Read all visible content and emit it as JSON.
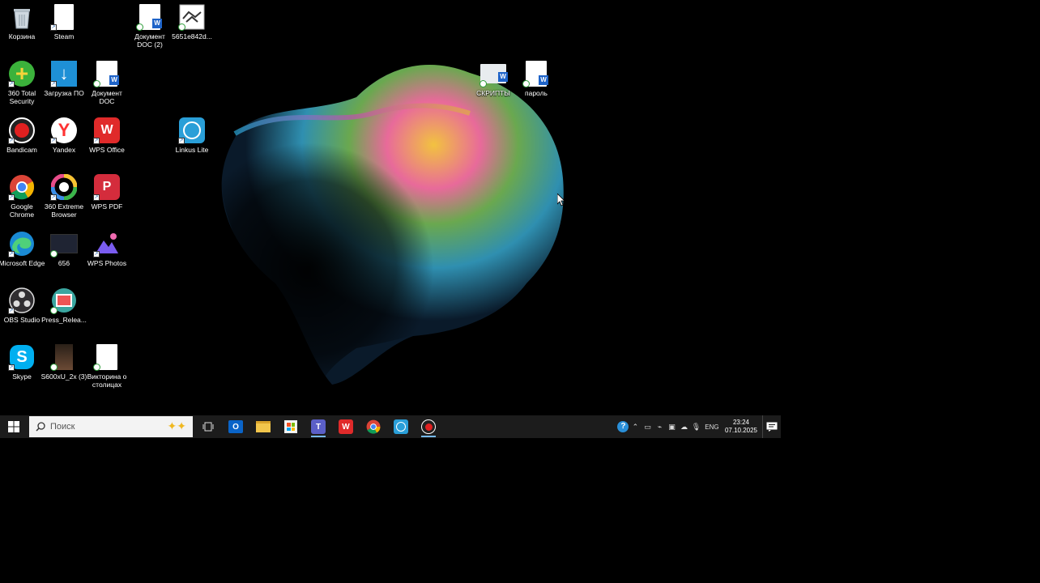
{
  "desktop": {
    "icons": [
      {
        "id": "recycle",
        "label": "Корзина"
      },
      {
        "id": "steam",
        "label": "Steam"
      },
      {
        "id": "doc-doc2",
        "label": "Документ DOC (2)"
      },
      {
        "id": "hash-file",
        "label": "5651e842d..."
      },
      {
        "id": "360ts",
        "label": "360 Total Security"
      },
      {
        "id": "zagruzka",
        "label": "Загрузка ПО"
      },
      {
        "id": "doc-doc",
        "label": "Документ DOC"
      },
      {
        "id": "scripts",
        "label": "СКРИПТЫ"
      },
      {
        "id": "parol",
        "label": "пароль"
      },
      {
        "id": "bandicam",
        "label": "Bandicam"
      },
      {
        "id": "yandex",
        "label": "Yandex"
      },
      {
        "id": "wps-office",
        "label": "WPS Office"
      },
      {
        "id": "linkus",
        "label": "Linkus Lite"
      },
      {
        "id": "chrome",
        "label": "Google Chrome"
      },
      {
        "id": "360browser",
        "label": "360 Extreme Browser"
      },
      {
        "id": "wps-pdf",
        "label": "WPS PDF"
      },
      {
        "id": "edge",
        "label": "Microsoft Edge"
      },
      {
        "id": "f656",
        "label": "656"
      },
      {
        "id": "wps-photos",
        "label": "WPS Photos"
      },
      {
        "id": "obs",
        "label": "OBS Studio"
      },
      {
        "id": "press",
        "label": "Press_Relea..."
      },
      {
        "id": "skype",
        "label": "Skype"
      },
      {
        "id": "s600",
        "label": "S600xU_2x (3)"
      },
      {
        "id": "viktorina",
        "label": "Викторина о столицах"
      }
    ]
  },
  "taskbar": {
    "search_placeholder": "Поиск",
    "pinned": [
      "task-view",
      "outlook",
      "file-explorer",
      "store",
      "teams",
      "wps-office",
      "chrome",
      "linkus",
      "bandicam"
    ],
    "tray": {
      "language": "ENG",
      "time": "23:24",
      "date": "07.10.2025"
    }
  },
  "colors": {
    "taskbar_bg": "#1c1c1c",
    "active_indicator": "#76b9ed",
    "search_bg": "#f3f3f3"
  }
}
